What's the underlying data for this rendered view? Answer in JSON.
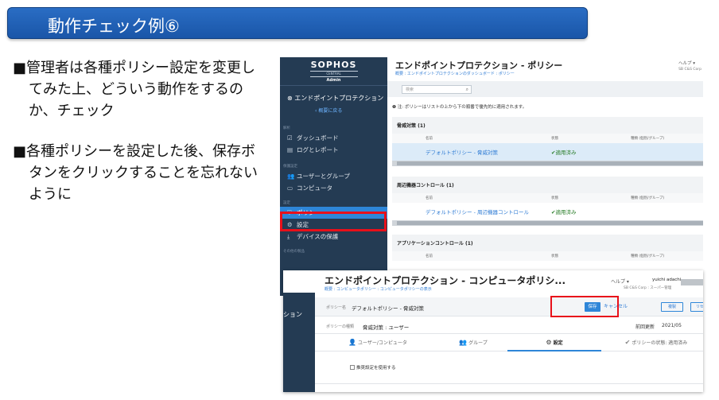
{
  "slide": {
    "title": "動作チェック例⑥",
    "bullets": [
      "■管理者は各種ポリシー設定を変更してみた上、どういう動作をするのか、チェック",
      "■各種ポリシーを設定した後、保存ボタンをクリックすることを忘れないように"
    ]
  },
  "sidebar": {
    "brand": "SOPHOS",
    "brand_sub": "CENTRAL",
    "brand_role": "Admin",
    "product": "エンドポイントプロテクション",
    "back": "概要に戻る",
    "sections": {
      "analysis": "解析",
      "protect": "保護設定",
      "config": "設定",
      "other": "その他の製品"
    },
    "items": {
      "dashboard": "ダッシュボード",
      "logs": "ログとレポート",
      "users": "ユーザーとグループ",
      "computers": "コンピュータ",
      "policies": "ポリシー",
      "settings": "設定",
      "device": "デバイスの保護"
    }
  },
  "policy_page": {
    "title": "エンドポイントプロテクション - ポリシー",
    "help": "ヘルプ ▾",
    "corp": "SB C&S Corp",
    "breadcrumb": "概要 : エンドポイントプロテクションのダッシュボード : ポリシー",
    "search_placeholder": "検索",
    "note": "注: ポリシーはリストの上から下の順番で優先的に適用されます。",
    "groups": [
      {
        "title": "脅威対策 (1)",
        "col_name": "名前",
        "col_status": "状態",
        "col_target": "種類 (個別/グループ)",
        "row_name": "デフォルトポリシー - 脅威対策",
        "row_status": "✔適用済み"
      },
      {
        "title": "周辺機器コントロール (1)",
        "col_name": "名前",
        "col_status": "状態",
        "col_target": "種類 (個別/グループ)",
        "row_name": "デフォルトポリシー - 周辺機器コントロール",
        "row_status": "✔適用済み"
      },
      {
        "title": "アプリケーションコントロール (1)",
        "col_name": "名前",
        "col_status": "状態",
        "col_target": "種類 (個別/グループ)"
      }
    ]
  },
  "edit_page": {
    "sidebar_label": "ション",
    "title": "エンドポイントプロテクション - コンピュータポリシ...",
    "breadcrumb": "概要 : コンピュータポリシー : コンピュータポリシーの表示",
    "help": "ヘルプ ▾",
    "user": "yuichi adachi",
    "corp": "SB C&S Corp : スーパー管理",
    "policy_name_label": "ポリシー名",
    "policy_name": "デフォルトポリシー - 脅威対策",
    "save": "保存",
    "cancel": "キャンセル",
    "copy": "複製",
    "reset": "リセット",
    "policy_type_label": "ポリシーの種類",
    "policy_type": "脅威対策 : ユーザー",
    "updated_label": "前回更新",
    "updated_value": "2021/05",
    "tabs": [
      "ユーザー/コンピュータ",
      "グループ",
      "設定",
      "ポリシーの状態: 適用済み"
    ],
    "checkbox": "推奨設定を使用する"
  },
  "colors": {
    "accent": "#2e86d8",
    "highlight": "#e8101a",
    "sidebar_bg": "#243b53",
    "banner": "#1a56a8"
  }
}
